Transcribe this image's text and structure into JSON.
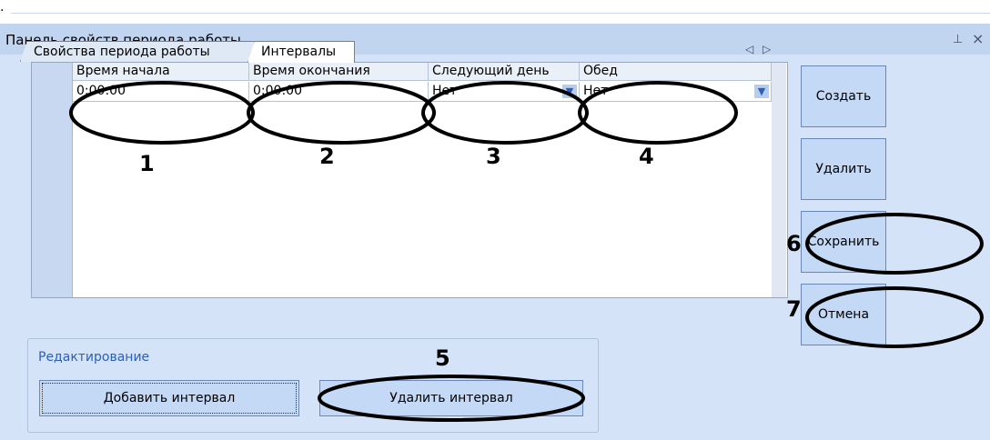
{
  "panel": {
    "title": "Панель свойств периода работы",
    "pin_icon": "pin-icon",
    "close_icon": "close-icon"
  },
  "tabs": [
    {
      "label": "Свойства периода работы"
    },
    {
      "label": "Интервалы"
    }
  ],
  "nav": {
    "left": "◁",
    "right": "▷"
  },
  "table": {
    "columns": [
      "Время начала",
      "Время окончания",
      "Следующий день",
      "Обед"
    ],
    "rows": [
      [
        "0:00:00",
        "0:00:00",
        "Нет",
        "Нет"
      ]
    ]
  },
  "side_buttons": {
    "create": "Создать",
    "delete": "Удалить",
    "save": "Сохранить",
    "cancel": "Отмена"
  },
  "editing": {
    "group_label": "Редактирование",
    "add_interval": "Добавить интервал",
    "delete_interval": "Удалить интервал"
  },
  "annotations": [
    "1",
    "2",
    "3",
    "4",
    "5",
    "6",
    "7"
  ],
  "colors": {
    "panel_bg": "#d4e3f7",
    "titlebar": "#c2d5f0",
    "button": "#c4d9f6",
    "group_label": "#2b5fb9"
  }
}
